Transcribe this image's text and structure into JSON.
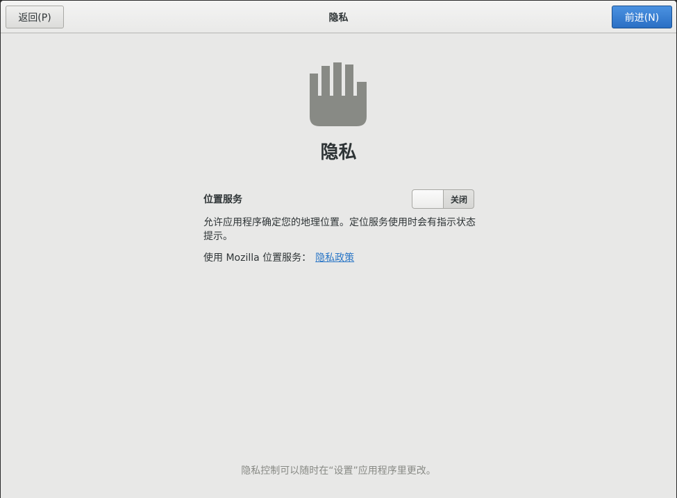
{
  "header": {
    "title": "隐私",
    "back_label": "返回(P)",
    "next_label": "前进(N)"
  },
  "main": {
    "icon": "hand-icon",
    "heading": "隐私",
    "location": {
      "label": "位置服务",
      "toggle_state": "关闭",
      "description": "允许应用程序确定您的地理位置。定位服务使用时会有指示状态提示。",
      "mozilla_text": "使用  Mozilla 位置服务：",
      "policy_link": "隐私政策"
    },
    "footer_note": "隐私控制可以随时在“设置”应用程序里更改。"
  },
  "colors": {
    "accent": "#3584e4",
    "link": "#2a76c6",
    "background": "#e8e8e7"
  }
}
